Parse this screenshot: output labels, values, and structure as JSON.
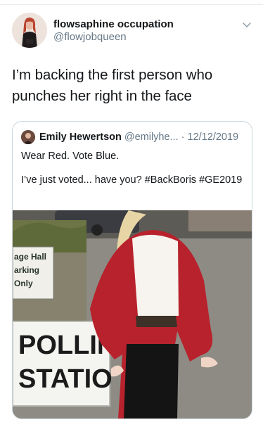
{
  "tweet": {
    "display_name": "flowsaphine occupation",
    "handle": "@flowjobqueen",
    "text": "I’m backing the first person who punches her right in the face"
  },
  "quoted": {
    "display_name": "Emily Hewertson",
    "handle_date": "@emilyhe... · 12/12/2019",
    "line1": "Wear Red. Vote Blue.",
    "line2": "I’ve just voted... have you? #BackBoris #GE2019",
    "media": {
      "sign_small_lines": [
        "age Hall",
        "arking",
        "Only"
      ],
      "sign_large_lines": [
        "POLLIN",
        "STATIO"
      ]
    }
  },
  "icons": {
    "chevron": "chevron-down-icon",
    "avatar": "avatar",
    "quoted_avatar": "avatar"
  },
  "colors": {
    "link": "#1da1f2",
    "secondary_text": "#657786",
    "border": "#ccd6dd",
    "jacket": "#b8222c"
  }
}
